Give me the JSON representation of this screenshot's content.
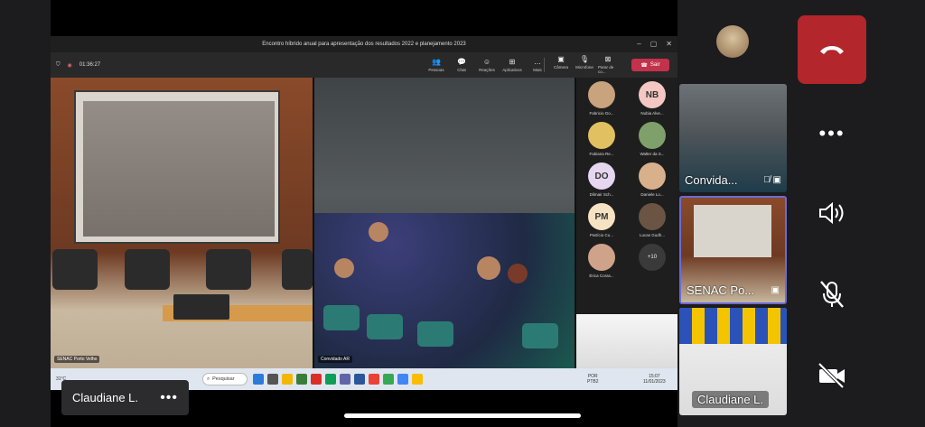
{
  "teams": {
    "window_title": "Encontro híbrido anual para apresentação dos resultados 2022 e planejamento 2023",
    "timer": "01:36:27",
    "toolbar": {
      "pessoas": "Pessoas",
      "chat": "Chat",
      "reacoes": "Reações",
      "aplicativos": "Aplicativos",
      "mais": "Mais",
      "camera": "Câmera",
      "microfone": "Microfone",
      "parar": "Parar de co...",
      "sair": "Sair"
    },
    "tiles": {
      "left_label": "SENAC Porto Velho",
      "main_label": "Convidado AR"
    },
    "roster": [
      {
        "name": "Fabricio Go...",
        "initials": "",
        "color": "#c9a27e"
      },
      {
        "name": "Nubia Alve...",
        "initials": "NB",
        "color": "#f4c7c3"
      },
      {
        "name": "Fabiana Re...",
        "initials": "",
        "color": "#e0c060"
      },
      {
        "name": "Walter da S...",
        "initials": "",
        "color": "#7fa06a"
      },
      {
        "name": "Dilmair Sch...",
        "initials": "DO",
        "color": "#e6d6f0"
      },
      {
        "name": "Daniele Lo...",
        "initials": "",
        "color": "#d9b08c"
      },
      {
        "name": "Patrício Cu...",
        "initials": "PM",
        "color": "#f6e3c3"
      },
      {
        "name": "Lucas Gudh...",
        "initials": "",
        "color": "#6b5443"
      },
      {
        "name": "Érica Coras...",
        "initials": "",
        "color": "#cfa38a"
      }
    ],
    "more_count": "+10"
  },
  "taskbar": {
    "temp": "31°C",
    "search_label": "Pesquisar",
    "lang": "POR",
    "kbd": "PTB2",
    "time": "15:07",
    "date": "11/01/2023"
  },
  "phone": {
    "self_chip_name": "Claudiane L.",
    "tile1_name": "Convida...",
    "tile2_name": "SENAC Po...",
    "tile3_name": "Claudiane L."
  }
}
